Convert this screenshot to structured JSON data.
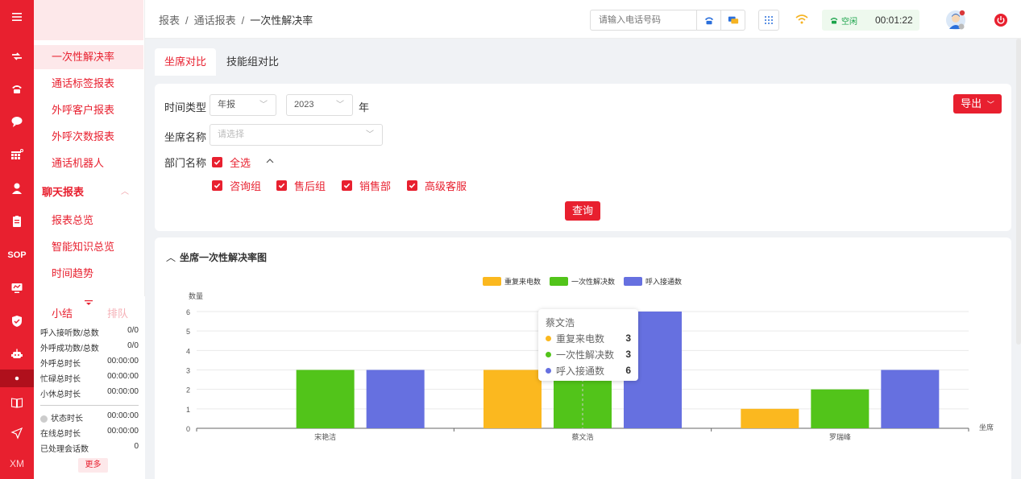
{
  "rail": {
    "items": [
      {
        "icon": "menu-icon"
      },
      {
        "icon": "transfer-icon"
      },
      {
        "icon": "telephone-icon"
      },
      {
        "icon": "chat-icon"
      },
      {
        "icon": "report-grid-icon"
      },
      {
        "icon": "user-icon"
      },
      {
        "icon": "clipboard-icon"
      },
      {
        "icon": "sop-icon",
        "text": "SOP"
      },
      {
        "icon": "monitor-icon"
      },
      {
        "icon": "shield-icon"
      },
      {
        "icon": "robot-icon"
      },
      {
        "icon": "book-icon"
      },
      {
        "icon": "send-icon"
      },
      {
        "icon": "xm-icon",
        "text": "XM"
      }
    ]
  },
  "submenu": {
    "items": [
      {
        "label": "一次性解决率",
        "active": true
      },
      {
        "label": "通话标签报表"
      },
      {
        "label": "外呼客户报表"
      },
      {
        "label": "外呼次数报表"
      },
      {
        "label": "通话机器人"
      }
    ],
    "group": "聊天报表",
    "group_items": [
      {
        "label": "报表总览"
      },
      {
        "label": "智能知识总览"
      },
      {
        "label": "时间趋势"
      }
    ]
  },
  "summary": {
    "tab_active": "小结",
    "tab_inactive": "排队",
    "rows": [
      {
        "label": "呼入接听数/总数",
        "value": "0/0"
      },
      {
        "label": "外呼成功数/总数",
        "value": "0/0"
      },
      {
        "label": "外呼总时长",
        "value": "00:00:00"
      },
      {
        "label": "忙碌总时长",
        "value": "00:00:00"
      },
      {
        "label": "小休总时长",
        "value": "00:00:00"
      }
    ],
    "rows2": [
      {
        "label": "状态时长",
        "value": "00:00:00"
      },
      {
        "label": "在线总时长",
        "value": "00:00:00"
      },
      {
        "label": "已处理会话数",
        "value": "0"
      }
    ],
    "more": "更多"
  },
  "topbar": {
    "breadcrumb": [
      "报表",
      "通话报表",
      "一次性解决率"
    ],
    "phone_placeholder": "请输入电话号码",
    "status": "空闲",
    "timer": "00:01:22"
  },
  "tabs": [
    {
      "label": "坐席对比",
      "active": true
    },
    {
      "label": "技能组对比"
    }
  ],
  "filters": {
    "time_type_label": "时间类型",
    "time_type_value": "年报",
    "year_value": "2023",
    "year_unit": "年",
    "agent_label": "坐席名称",
    "agent_placeholder": "请选择",
    "dept_label": "部门名称",
    "select_all": "全选",
    "depts": [
      "咨询组",
      "售后组",
      "销售部",
      "高级客服"
    ],
    "query": "查询",
    "export": "导出"
  },
  "chart_title": "坐席一次性解决率图",
  "chart_data": {
    "type": "bar",
    "ylabel": "数量",
    "xlabel": "坐席",
    "ylim": [
      0,
      6
    ],
    "yticks": [
      0,
      1,
      2,
      3,
      4,
      5,
      6
    ],
    "categories": [
      "宋艳洁",
      "蔡文浩",
      "罗瑞峰"
    ],
    "series": [
      {
        "name": "重复来电数",
        "color": "#fbb81f",
        "values": [
          0,
          3,
          1
        ]
      },
      {
        "name": "一次性解决数",
        "color": "#52c41a",
        "values": [
          3,
          3,
          2
        ]
      },
      {
        "name": "呼入接通数",
        "color": "#6670e0",
        "values": [
          3,
          6,
          3
        ]
      }
    ],
    "legend": "top-center",
    "grid": true
  },
  "tooltip": {
    "title": "蔡文浩",
    "rows": [
      {
        "name": "重复来电数",
        "value": "3",
        "color": "#fbb81f"
      },
      {
        "name": "一次性解决数",
        "value": "3",
        "color": "#52c41a"
      },
      {
        "name": "呼入接通数",
        "value": "6",
        "color": "#6670e0"
      }
    ]
  }
}
